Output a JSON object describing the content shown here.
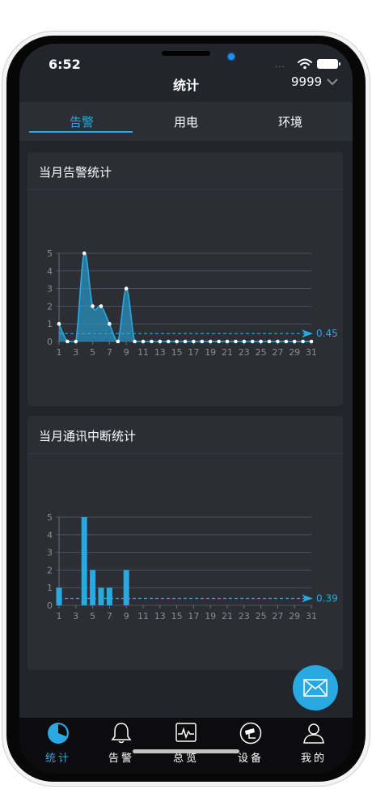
{
  "status_bar": {
    "time": "6:52",
    "signal": "···"
  },
  "header": {
    "title": "统计",
    "site": "9999"
  },
  "tabs": [
    {
      "label": "告警",
      "active": true
    },
    {
      "label": "用电",
      "active": false
    },
    {
      "label": "环境",
      "active": false
    }
  ],
  "cards": [
    {
      "title": "当月告警统计"
    },
    {
      "title": "当月通讯中断统计"
    }
  ],
  "bottom_nav": [
    {
      "label": "统计",
      "icon": "pie-chart-icon",
      "active": true
    },
    {
      "label": "告警",
      "icon": "bell-icon",
      "active": false
    },
    {
      "label": "总览",
      "icon": "monitor-icon",
      "active": false
    },
    {
      "label": "设备",
      "icon": "camera-icon",
      "active": false
    },
    {
      "label": "我的",
      "icon": "user-icon",
      "active": false
    }
  ],
  "colors": {
    "accent": "#29a9e1",
    "background": "#22252b",
    "card": "#2b2e35"
  },
  "chart_data": [
    {
      "type": "area",
      "x": [
        1,
        2,
        3,
        4,
        5,
        6,
        7,
        8,
        9,
        10,
        11,
        12,
        13,
        14,
        15,
        16,
        17,
        18,
        19,
        20,
        21,
        22,
        23,
        24,
        25,
        26,
        27,
        28,
        29,
        30,
        31
      ],
      "values": [
        1,
        0,
        0,
        5,
        2,
        2,
        1,
        0,
        3,
        0,
        0,
        0,
        0,
        0,
        0,
        0,
        0,
        0,
        0,
        0,
        0,
        0,
        0,
        0,
        0,
        0,
        0,
        0,
        0,
        0,
        0
      ],
      "x_ticks": [
        1,
        3,
        5,
        7,
        9,
        11,
        13,
        15,
        17,
        19,
        21,
        23,
        25,
        27,
        29,
        31
      ],
      "y_ticks": [
        0,
        1,
        2,
        3,
        4,
        5
      ],
      "ylim": [
        0,
        5
      ],
      "average": 0.45,
      "average_label": "0.45",
      "grid": true
    },
    {
      "type": "bar",
      "x": [
        1,
        2,
        3,
        4,
        5,
        6,
        7,
        8,
        9,
        10,
        11,
        12,
        13,
        14,
        15,
        16,
        17,
        18,
        19,
        20,
        21,
        22,
        23,
        24,
        25,
        26,
        27,
        28,
        29,
        30,
        31
      ],
      "values": [
        1,
        0,
        0,
        5,
        2,
        1,
        1,
        0,
        2,
        0,
        0,
        0,
        0,
        0,
        0,
        0,
        0,
        0,
        0,
        0,
        0,
        0,
        0,
        0,
        0,
        0,
        0,
        0,
        0,
        0,
        0
      ],
      "x_ticks": [
        1,
        3,
        5,
        7,
        9,
        11,
        13,
        15,
        17,
        19,
        21,
        23,
        25,
        27,
        29,
        31
      ],
      "y_ticks": [
        0,
        1,
        2,
        3,
        4,
        5
      ],
      "ylim": [
        0,
        5
      ],
      "average": 0.39,
      "average_label": "0.39",
      "grid": true
    }
  ]
}
